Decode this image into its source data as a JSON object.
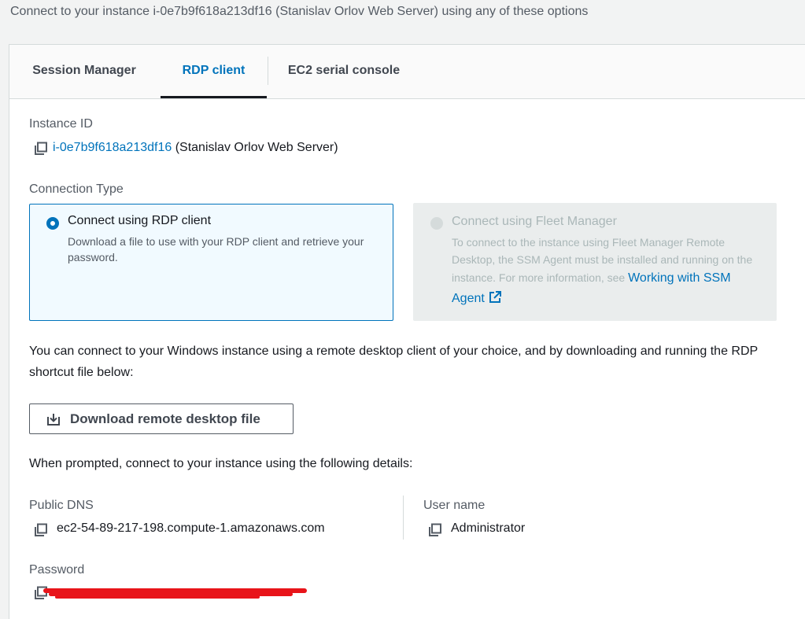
{
  "header": {
    "description": "Connect to your instance i-0e7b9f618a213df16 (Stanislav Orlov Web Server) using any of these options"
  },
  "tabs": [
    {
      "label": "Session Manager",
      "active": false
    },
    {
      "label": "RDP client",
      "active": true
    },
    {
      "label": "EC2 serial console",
      "active": false
    }
  ],
  "instance": {
    "label": "Instance ID",
    "id": "i-0e7b9f618a213df16",
    "name": "(Stanislav Orlov Web Server)"
  },
  "connection_type": {
    "label": "Connection Type",
    "rdp": {
      "title": "Connect using RDP client",
      "description": "Download a file to use with your RDP client and retrieve your password.",
      "selected": true
    },
    "fleet": {
      "title": "Connect using Fleet Manager",
      "description": "To connect to the instance using Fleet Manager Remote Desktop, the SSM Agent must be installed and running on the instance. For more information, see",
      "link_text": "Working with SSM Agent",
      "disabled": true
    }
  },
  "instructions": {
    "intro": "You can connect to your Windows instance using a remote desktop client of your choice, and by downloading and running the RDP shortcut file below:",
    "download_button": "Download remote desktop file",
    "prompt": "When prompted, connect to your instance using the following details:"
  },
  "details": {
    "public_dns_label": "Public DNS",
    "public_dns": "ec2-54-89-217-198.compute-1.amazonaws.com",
    "username_label": "User name",
    "username": "Administrator",
    "password_label": "Password"
  },
  "colors": {
    "accent": "#0073bb",
    "redaction": "#e8141a"
  }
}
